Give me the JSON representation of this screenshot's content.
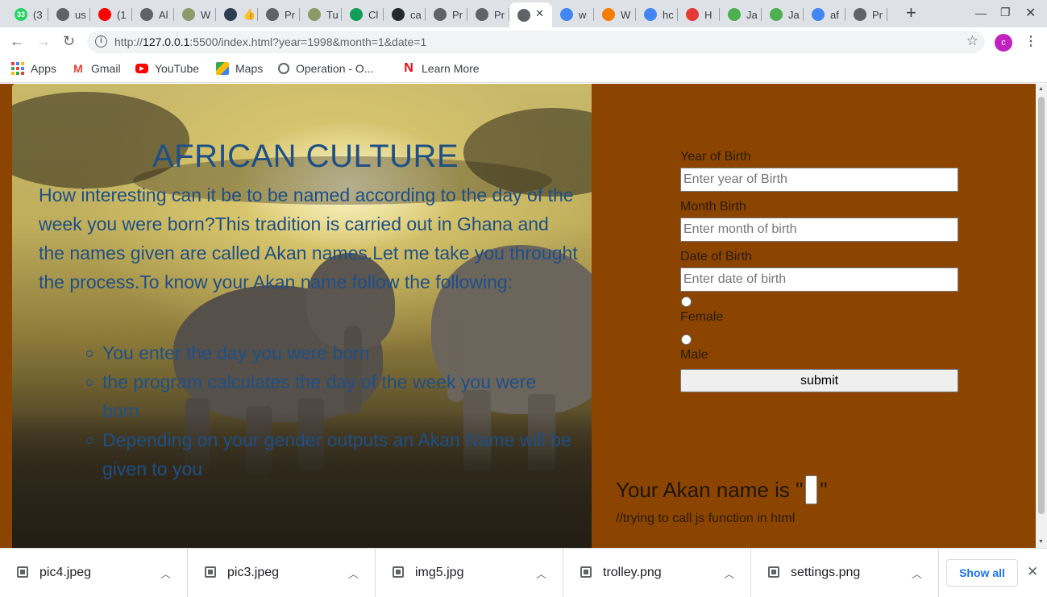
{
  "browser": {
    "tabs": [
      {
        "label": "(3",
        "icon": "whatsapp-icon",
        "color": "#25d366",
        "badge": "33"
      },
      {
        "label": "us",
        "icon": "globe-icon",
        "color": "#5f6368"
      },
      {
        "label": "(1",
        "icon": "youtube-icon",
        "color": "#ff0000"
      },
      {
        "label": "Al",
        "icon": "globe-icon",
        "color": "#5f6368"
      },
      {
        "label": "W",
        "icon": "palm-icon",
        "color": "#8d9b6a"
      },
      {
        "label": "👍",
        "icon": "pen-icon",
        "color": "#2d3d52"
      },
      {
        "label": "Pr",
        "icon": "globe-icon",
        "color": "#5f6368"
      },
      {
        "label": "Tu",
        "icon": "palm-icon",
        "color": "#8d9b6a"
      },
      {
        "label": "Cl",
        "icon": "plus-square-icon",
        "color": "#0f9d58"
      },
      {
        "label": "ca",
        "icon": "github-icon",
        "color": "#24292e"
      },
      {
        "label": "Pr",
        "icon": "globe-icon",
        "color": "#5f6368"
      },
      {
        "label": "Pr",
        "icon": "globe-icon",
        "color": "#5f6368"
      },
      {
        "label": "",
        "icon": "globe-icon",
        "color": "#5f6368",
        "active": true
      },
      {
        "label": "w",
        "icon": "google-icon",
        "color": "#4285f4"
      },
      {
        "label": "W",
        "icon": "play-icon",
        "color": "#f57c00"
      },
      {
        "label": "hc",
        "icon": "google-icon",
        "color": "#4285f4"
      },
      {
        "label": "H",
        "icon": "vivaldi-icon",
        "color": "#e53935"
      },
      {
        "label": "Ja",
        "icon": "w3-icon",
        "color": "#4caf50"
      },
      {
        "label": "Ja",
        "icon": "w3-icon",
        "color": "#4caf50"
      },
      {
        "label": "af",
        "icon": "google-icon",
        "color": "#4285f4"
      },
      {
        "label": "Pr",
        "icon": "globe-icon",
        "color": "#5f6368"
      }
    ],
    "url_host": "127.0.0.1",
    "url_prefix": "http://",
    "url_rest": ":5500/index.html?year=1998&month=1&date=1",
    "profile_initial": "c",
    "bookmarks": [
      {
        "label": "Apps",
        "icon": "apps-grid-icon"
      },
      {
        "label": "Gmail",
        "icon": "gmail-icon"
      },
      {
        "label": "YouTube",
        "icon": "youtube-icon"
      },
      {
        "label": "Maps",
        "icon": "maps-icon"
      },
      {
        "label": "Operation - O...",
        "icon": "globe-icon"
      },
      {
        "label": "Learn More",
        "icon": "netflix-icon"
      }
    ]
  },
  "page": {
    "title": "AFRICAN CULTURE",
    "intro": "How interesting can it be to be named according to the day of the week you were born?This tradition is carried out in Ghana and the names given are called Akan names.Let me take you throught the process.To know your Akan name follow the following:",
    "steps": [
      "You enter the day you were born",
      "the program calculates the day of the week you were born",
      "Depending on your gender outputs an Akan Name will be given to you"
    ],
    "form": {
      "year_label": "Year of Birth",
      "year_placeholder": "Enter year of Birth",
      "month_label": "Month Birth",
      "month_placeholder": "Enter month of birth",
      "date_label": "Date of Birth",
      "date_placeholder": "Enter date of birth",
      "female_label": "Female",
      "male_label": "Male",
      "submit_label": "submit"
    },
    "result_prefix": "Your Akan name is \"",
    "result_suffix": "\"",
    "comment": "//trying to call js function in html"
  },
  "downloads": {
    "files": [
      "pic4.jpeg",
      "pic3.jpeg",
      "img5.jpg",
      "trolley.png",
      "settings.png"
    ],
    "show_all": "Show all"
  }
}
